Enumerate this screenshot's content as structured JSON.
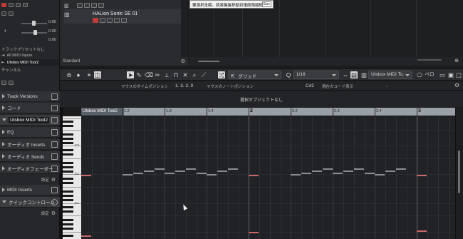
{
  "inspector": {
    "master_values": [
      "0.00",
      "0.00",
      "0.00"
    ],
    "track_settings_label": "トラックプリセットなし",
    "midi_in": "All MIDI Inputs",
    "midi_out": "Utsbox MIDI Tool2",
    "channel_label": "チャンネル",
    "sections": [
      {
        "label": "Track Versions"
      },
      {
        "label": "コード"
      },
      {
        "label": "Utsbox MIDI Tool2"
      },
      {
        "label": "EQ"
      },
      {
        "label": "オーディオ Inserts"
      },
      {
        "label": "オーディオ Sends"
      },
      {
        "label": "オーディオフェーダー"
      },
      {
        "label": "MIDI Inserts"
      },
      {
        "label": "クイックコントロール"
      }
    ],
    "settings_label": "設定",
    "settings_label2": "設定"
  },
  "tracks": {
    "instrument_name": "HALion Sonic SE 01",
    "preset_label": "Standard"
  },
  "tooltip": {
    "text": "要選択全解。請將鍵盤移動到譜面頭縮檢",
    "key": "Esc"
  },
  "toolbar": {
    "quantize_mode": "グリッド",
    "quantize_value": "1/16",
    "instrument": "Utsbox MIDI To.",
    "extra": "ベロ"
  },
  "infoline": {
    "mouse_time_label": "マウスのタイムポジション",
    "mouse_time_value": "1. 3. 2.  0",
    "mouse_note_label": "マウスのノートポジション",
    "mouse_note_value": "C#2",
    "chord_label": "現在のコード表示",
    "chord_value": "-"
  },
  "status": {
    "text": "選択オブジェクトなし"
  },
  "ruler": {
    "part_name": "Utsbox MIDI Tool2",
    "labels": [
      "1.2",
      "1.3",
      "1.4",
      "2",
      "2.2",
      "2.3",
      "2.4",
      "3"
    ]
  },
  "keyboard": {
    "c_labels": [
      "C3",
      "C2",
      "C1"
    ]
  },
  "colors": {
    "note": "#8a8c90",
    "note_selected": "#c96a6a",
    "record": "#c23a3a"
  }
}
